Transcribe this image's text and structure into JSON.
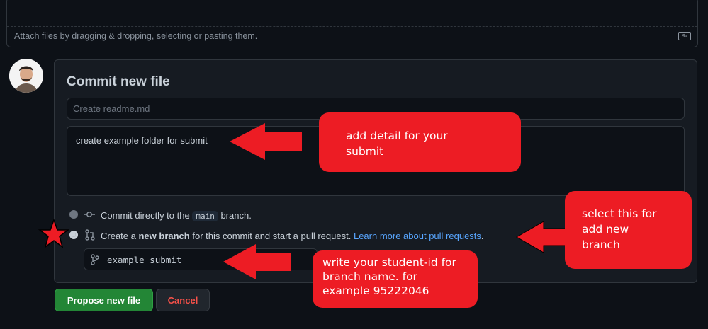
{
  "attach": {
    "text": "Attach files by dragging & dropping, selecting or pasting them.",
    "md_icon": "markdown-icon"
  },
  "commit": {
    "title": "Commit new file",
    "summary_placeholder": "Create readme.md",
    "description_value": "create example folder for submit",
    "options": {
      "direct_prefix": "Commit directly to the ",
      "direct_branch": "main",
      "direct_suffix": " branch.",
      "branch_prefix": "Create a ",
      "branch_bold": "new branch",
      "branch_suffix": " for this commit and start a pull request.",
      "branch_link": "Learn more about pull requests",
      "branch_end": "."
    },
    "branch_name_value": "example_submit",
    "propose_label": "Propose new file",
    "cancel_label": "Cancel"
  },
  "annotations": {
    "callout_1": [
      "add detail for your",
      "submit"
    ],
    "callout_2": [
      "select this for",
      "add new",
      "branch"
    ],
    "callout_3": [
      "write your student-id for",
      "branch name. for",
      "example 95222046"
    ],
    "color": "#ed1c24"
  },
  "colors": {
    "background": "#0d1117",
    "panel": "#161b22",
    "accent_green": "#238636",
    "link": "#58a6ff",
    "danger": "#f85149"
  },
  "icons": [
    "markdown-icon",
    "avatar",
    "git-commit-icon",
    "git-pull-request-icon",
    "git-branch-icon",
    "star-icon",
    "arrow-icon"
  ]
}
